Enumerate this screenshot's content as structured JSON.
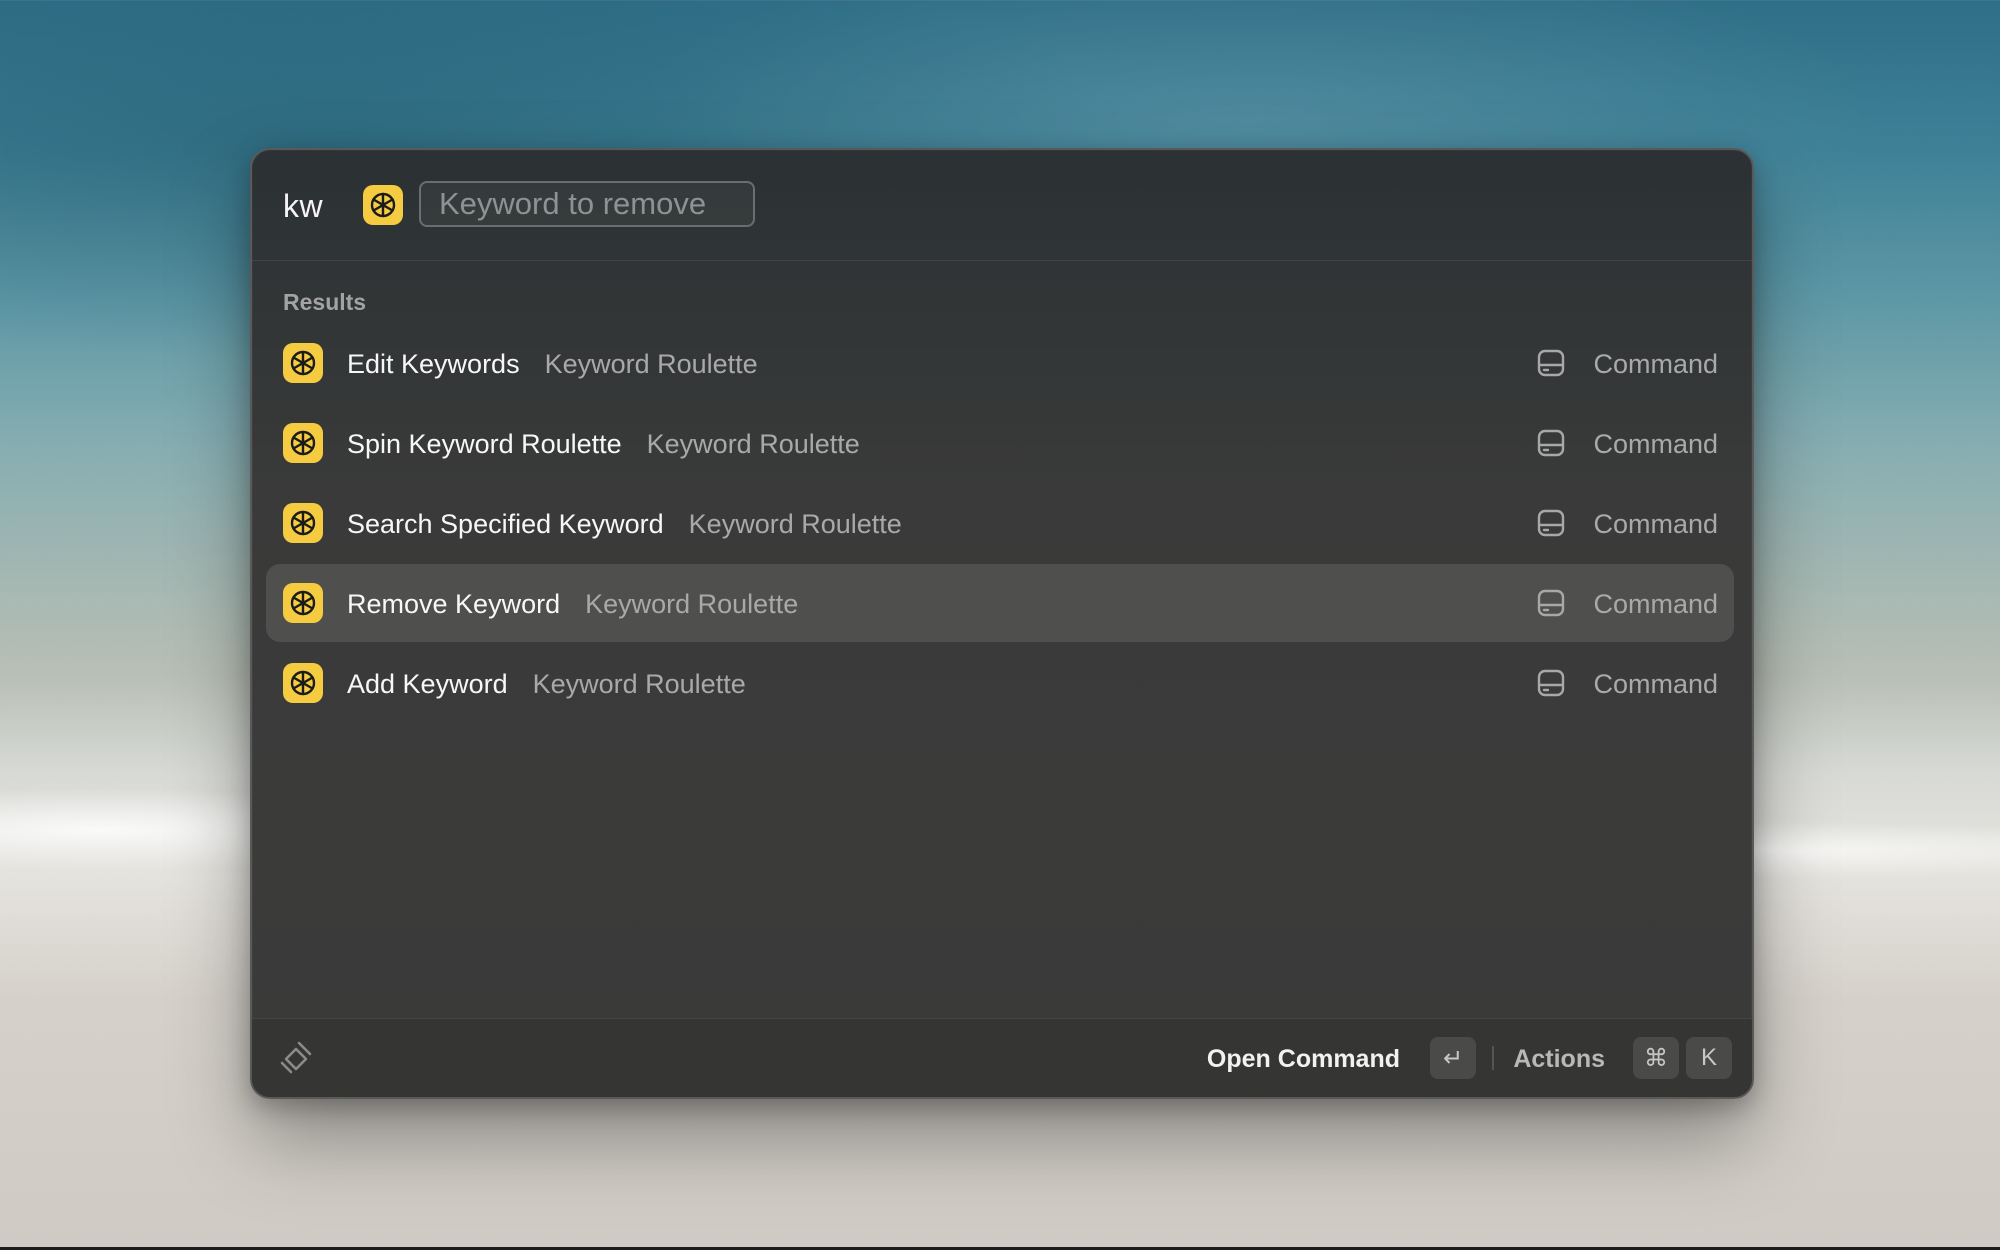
{
  "search": {
    "query": "kw",
    "argument_placeholder": "Keyword to remove",
    "command_icon": "keyword-roulette-icon"
  },
  "results": {
    "section_title": "Results",
    "items": [
      {
        "title": "Edit Keywords",
        "subtitle": "Keyword Roulette",
        "type": "Command",
        "icon": "keyword-roulette-icon",
        "accessory_icon": "hard-drive-icon",
        "selected": false
      },
      {
        "title": "Spin Keyword Roulette",
        "subtitle": "Keyword Roulette",
        "type": "Command",
        "icon": "keyword-roulette-icon",
        "accessory_icon": "hard-drive-icon",
        "selected": false
      },
      {
        "title": "Search Specified Keyword",
        "subtitle": "Keyword Roulette",
        "type": "Command",
        "icon": "keyword-roulette-icon",
        "accessory_icon": "hard-drive-icon",
        "selected": false
      },
      {
        "title": "Remove Keyword",
        "subtitle": "Keyword Roulette",
        "type": "Command",
        "icon": "keyword-roulette-icon",
        "accessory_icon": "hard-drive-icon",
        "selected": true
      },
      {
        "title": "Add Keyword",
        "subtitle": "Keyword Roulette",
        "type": "Command",
        "icon": "keyword-roulette-icon",
        "accessory_icon": "hard-drive-icon",
        "selected": false
      }
    ]
  },
  "footer": {
    "logo_icon": "raycast-logo-icon",
    "primary_action": "Open Command",
    "primary_shortcut": "↵",
    "secondary_action": "Actions",
    "secondary_shortcut_modifier": "⌘",
    "secondary_shortcut_key": "K"
  },
  "colors": {
    "accent_icon_bg": "#f5cb41",
    "selected_row_bg": "#4f4f4d",
    "window_bg": "#3a3a39"
  }
}
